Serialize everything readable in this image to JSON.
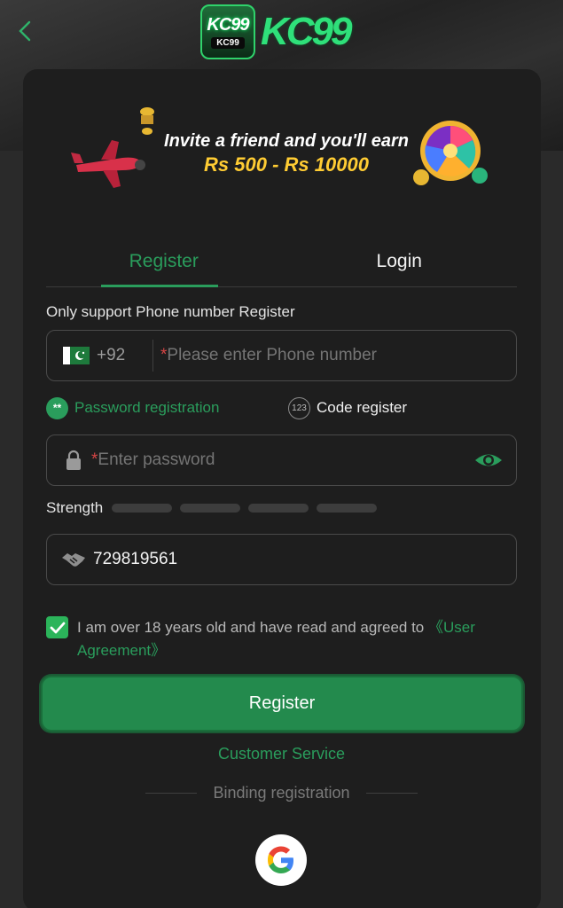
{
  "header": {
    "logo_badge_big": "KC99",
    "logo_badge_small": "KC99",
    "logo_text": "KC99"
  },
  "banner": {
    "line1": "Invite a friend and you'll earn",
    "line2": "Rs 500 - Rs 10000"
  },
  "tabs": [
    {
      "label": "Register",
      "active": true
    },
    {
      "label": "Login",
      "active": false
    }
  ],
  "form": {
    "note": "Only support Phone number Register",
    "country_code": "+92",
    "phone_placeholder": "Please enter Phone number",
    "required_mark": "*",
    "modes": [
      {
        "label": "Password registration",
        "icon": "**",
        "selected": true
      },
      {
        "label": "Code register",
        "icon": "123",
        "selected": false
      }
    ],
    "password_placeholder": "Enter password",
    "strength_label": "Strength",
    "strength_level": 0,
    "invite_code": "729819561",
    "agree_text": "I am over 18 years old and have read and agreed to ",
    "agree_link": "《User Agreement》",
    "agree_checked": true,
    "register_button": "Register",
    "customer_service": "Customer Service",
    "binding_label": "Binding registration"
  },
  "colors": {
    "accent": "#2a9d5c",
    "button": "#238a4d",
    "card": "#1e1e1e",
    "background": "#2a2a2a"
  }
}
